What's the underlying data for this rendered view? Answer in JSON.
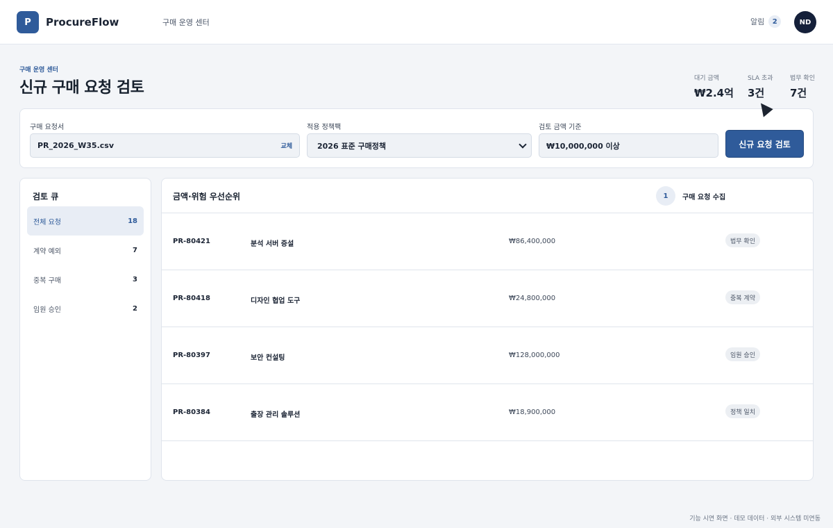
{
  "app": {
    "logo_letter": "P",
    "name": "ProcureFlow"
  },
  "topnav": {
    "link": "구매 운영 센터"
  },
  "alerts": {
    "label": "알림",
    "count": "2"
  },
  "user": {
    "initials": "ND"
  },
  "header": {
    "eyebrow": "구매 운영 센터",
    "title": "신규 구매 요청 검토",
    "stats": [
      {
        "label": "대기 금액",
        "value": "₩2.4억"
      },
      {
        "label": "SLA 초과",
        "value": "3건"
      },
      {
        "label": "법무 확인",
        "value": "7건"
      }
    ]
  },
  "filters": {
    "file": {
      "label": "구매 요청서",
      "value": "PR_2026_W35.csv",
      "action": "교체"
    },
    "policy": {
      "label": "적용 정책팩",
      "value": "2026 표준 구매정책"
    },
    "threshold": {
      "label": "검토 금액 기준",
      "value": "₩10,000,000 이상"
    },
    "submit_label": "신규 요청 검토"
  },
  "queue": {
    "title": "검토 큐",
    "items": [
      {
        "label": "전체 요청",
        "count": "18",
        "active": true
      },
      {
        "label": "계약 예외",
        "count": "7"
      },
      {
        "label": "중복 구매",
        "count": "3"
      },
      {
        "label": "임원 승인",
        "count": "2"
      }
    ]
  },
  "list": {
    "title": "금액·위험 우선순위",
    "step": {
      "number": "1",
      "label": "구매 요청 수집"
    },
    "rows": [
      {
        "id": "PR-80421",
        "name": "분석 서버 증설",
        "amount": "₩86,400,000",
        "tag": "법무 확인"
      },
      {
        "id": "PR-80418",
        "name": "디자인 협업 도구",
        "amount": "₩24,800,000",
        "tag": "중복 계약"
      },
      {
        "id": "PR-80397",
        "name": "보안 컨설팅",
        "amount": "₩128,000,000",
        "tag": "임원 승인"
      },
      {
        "id": "PR-80384",
        "name": "출장 관리 솔루션",
        "amount": "₩18,900,000",
        "tag": "정책 일치"
      }
    ]
  },
  "footnote": "기능 시연 화면 · 데모 데이터 · 외부 시스템 미연동",
  "colors": {
    "accent": "#2f5b9a",
    "background": "#f3f5f8",
    "avatar": "#15203a"
  }
}
